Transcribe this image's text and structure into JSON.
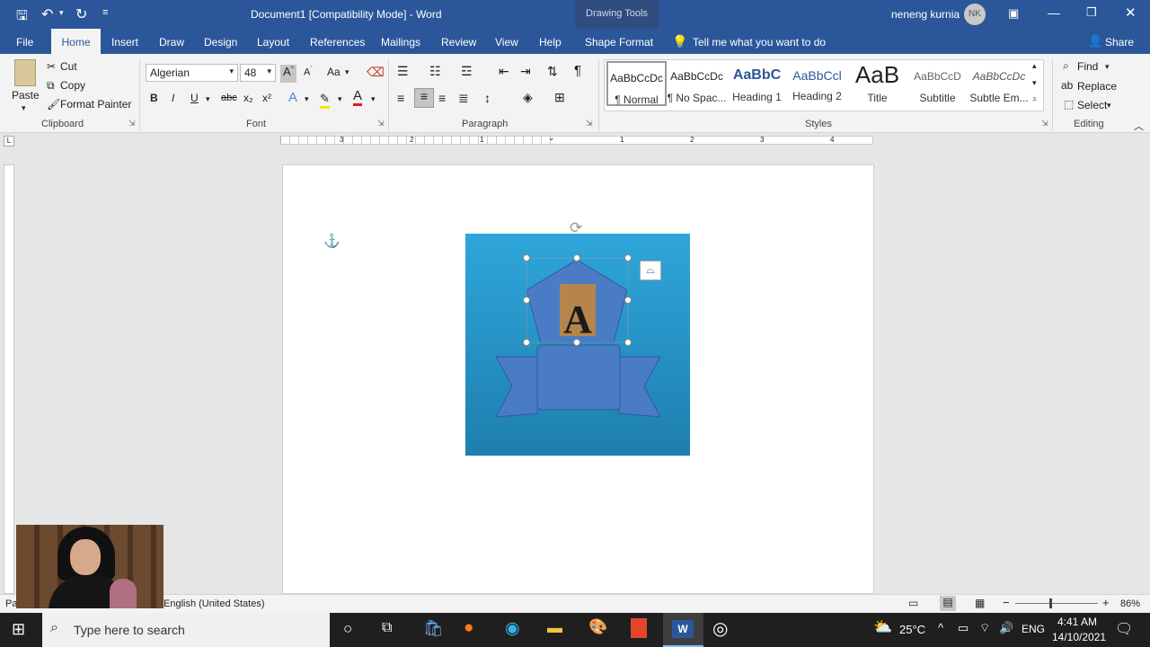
{
  "title_bar": {
    "document_title": "Document1 [Compatibility Mode]  -  Word",
    "drawing_tools": "Drawing Tools",
    "user_name": "neneng kurnia",
    "user_initials": "NK"
  },
  "tabs": [
    "File",
    "Home",
    "Insert",
    "Draw",
    "Design",
    "Layout",
    "References",
    "Mailings",
    "Review",
    "View",
    "Help",
    "Shape Format"
  ],
  "tell_me": "Tell me what you want to do",
  "share": "Share",
  "clipboard": {
    "paste": "Paste",
    "cut": "Cut",
    "copy": "Copy",
    "format_painter": "Format Painter",
    "group": "Clipboard"
  },
  "font": {
    "name": "Algerian",
    "size": "48",
    "group": "Font",
    "bold": "B",
    "italic": "I",
    "underline": "U",
    "strike": "abc",
    "subscript": "x₂",
    "superscript": "x²",
    "case": "Aa"
  },
  "paragraph": {
    "group": "Paragraph"
  },
  "styles": {
    "group": "Styles",
    "items": [
      {
        "sample": "AaBbCcDc",
        "name": "¶ Normal"
      },
      {
        "sample": "AaBbCcDc",
        "name": "¶ No Spac..."
      },
      {
        "sample": "AaBbC",
        "name": "Heading 1"
      },
      {
        "sample": "AaBbCcl",
        "name": "Heading 2"
      },
      {
        "sample": "AaB",
        "name": "Title"
      },
      {
        "sample": "AaBbCcD",
        "name": "Subtitle"
      },
      {
        "sample": "AaBbCcDc",
        "name": "Subtle Em..."
      }
    ]
  },
  "editing": {
    "find": "Find",
    "replace": "Replace",
    "select": "Select",
    "group": "Editing"
  },
  "ruler": {
    "numbers": [
      "3",
      "2",
      "1",
      "1",
      "2",
      "3",
      "4"
    ]
  },
  "status_bar": {
    "page": "Pa",
    "language": "English (United States)",
    "zoom": "86%"
  },
  "taskbar": {
    "search_placeholder": "Type here to search",
    "temperature": "25°C",
    "lang": "ENG",
    "time": "4:41 AM",
    "date": "14/10/2021"
  },
  "colors": {
    "word_blue": "#2b579a",
    "image_bg": "#2fa6db",
    "shape_fill": "#4a7cc6"
  }
}
